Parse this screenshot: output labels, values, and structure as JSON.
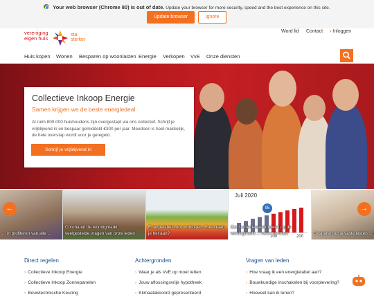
{
  "update_banner": {
    "title": "Your web browser (Chrome 80) is out of date.",
    "message": "Update your browser for more security, speed and the best experience on this site.",
    "update_label": "Update browser",
    "ignore_label": "Ignore"
  },
  "logo": {
    "line1": "vereniging",
    "line2": "eigen huis",
    "line3": "sta",
    "line4": "sterker"
  },
  "top_links": {
    "member": "Word lid",
    "contact": "Contact",
    "login": "Inloggen"
  },
  "nav": {
    "items": [
      "Huis kopen",
      "Wonen",
      "Besparen op woonlasten",
      "Energie",
      "Verkopen",
      "VvE",
      "Onze diensten"
    ]
  },
  "hero": {
    "title": "Collectieve Inkoop Energie",
    "subtitle": "Samen krijgen we de beste energiedeal",
    "body": "Al ruim 800.000 huishoudens zijn overgestapt via ons collectief. Schrijf je vrijblijvend in en bespaar gemiddeld €300 per jaar. Meedoen is heel makkelijk, de hele overstap wordt voor je geregeld.",
    "cta": "Schrijf je vrijblijvend in"
  },
  "carousel": {
    "tiles": [
      "... in profiteren van alle ...",
      "Corona en de woningmarkt: veelgestelde vragen van onze leden",
      "Energielabel voor woningen. Hoe vraag je het aan?",
      "Consumentenvertrouwen op de woningmarkt ... weer normaal",
      "Besparen op je vaste lasten ... tips"
    ],
    "chart_badge": "95",
    "chart_title": "Juli 2020",
    "chart_ticks": [
      "100",
      "200"
    ],
    "chart_bars": [
      0.35,
      0.42,
      0.5,
      0.56,
      0.62,
      0.68,
      0.74,
      0.8,
      0.85,
      0.9
    ]
  },
  "footer": {
    "col1": {
      "title": "Direct regelen",
      "links": [
        "Collectieve Inkoop Energie",
        "Collectieve Inkoop Zonnepanelen",
        "Bouwtechnische Keuring"
      ]
    },
    "col2": {
      "title": "Achtergronden",
      "links": [
        "Waar je als VvE op moet letten",
        "Jouw aflossingsvrije hypotheek",
        "Klimaatakkoord gepresenteerd"
      ]
    },
    "col3": {
      "title": "Vragen van leden",
      "links": [
        "Hoe vraag ik een energielabel aan?",
        "Bouwkundige inschakelen bij voorplevering?",
        "Hoeveel kan ik lenen?"
      ]
    }
  },
  "colors": {
    "brand_orange": "#f37021",
    "brand_red": "#d6191c",
    "link_blue": "#1b4f8a"
  }
}
